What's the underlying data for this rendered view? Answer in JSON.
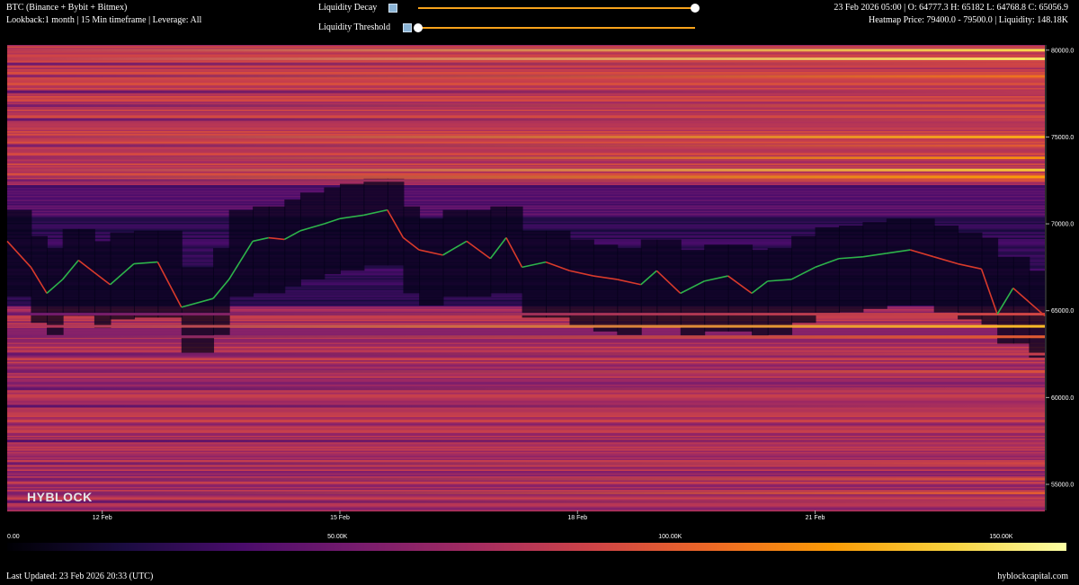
{
  "header": {
    "title": "BTC (Binance + Bybit + Bitmex)",
    "settings": "Lookback:1 month | 15 Min timeframe | Leverage: All",
    "ohlc": "23 Feb 2026 05:00 | O: 64777.3 H: 65182 L: 64768.8 C: 65056.9",
    "range": "Heatmap Price: 79400.0 - 79500.0 | Liquidity: 148.18K"
  },
  "controls": {
    "decay_label": "Liquidity Decay",
    "threshold_label": "Liquidity Threshold",
    "decay_value": 1.0,
    "threshold_value": 0.0
  },
  "brand": "HYBLOCK",
  "footer": {
    "updated": "Last Updated: 23 Feb 2026 20:33 (UTC)",
    "site": "hyblockcapital.com"
  },
  "colorscale": {
    "labels": [
      "0.00",
      "50.00K",
      "100.00K",
      "150.00K"
    ],
    "values": [
      0,
      50000,
      100000,
      150000
    ],
    "max": 160000,
    "stops": [
      "#000004",
      "#1b0c41",
      "#4a0c6b",
      "#781c6d",
      "#a52c60",
      "#cf4446",
      "#ed6925",
      "#fb9b06",
      "#f7d13d",
      "#fcffa4"
    ]
  },
  "chart_data": {
    "type": "heatmap",
    "ylim": [
      53500,
      80300
    ],
    "y_ticks": [
      55000,
      60000,
      65000,
      70000,
      75000,
      80000
    ],
    "y_tick_labels": [
      "55000.0",
      "60000.0",
      "65000.0",
      "70000.0",
      "75000.0",
      "80000.0"
    ],
    "x_ticks": [
      12,
      15,
      18,
      21
    ],
    "x_tick_labels": [
      "12 Feb",
      "15 Feb",
      "18 Feb",
      "21 Feb"
    ],
    "xlim": [
      10.8,
      23.9
    ],
    "price_series": {
      "name": "BTC",
      "x": [
        10.8,
        11.1,
        11.3,
        11.5,
        11.7,
        11.9,
        12.1,
        12.4,
        12.7,
        13.0,
        13.4,
        13.6,
        13.9,
        14.1,
        14.3,
        14.5,
        14.8,
        15.0,
        15.3,
        15.6,
        15.8,
        16.0,
        16.3,
        16.6,
        16.9,
        17.1,
        17.3,
        17.6,
        17.9,
        18.2,
        18.5,
        18.8,
        19.0,
        19.3,
        19.6,
        19.9,
        20.2,
        20.4,
        20.7,
        21.0,
        21.3,
        21.6,
        21.9,
        22.2,
        22.5,
        22.8,
        23.1,
        23.3,
        23.5,
        23.7,
        23.9
      ],
      "y": [
        69000,
        67500,
        66000,
        66800,
        67900,
        67200,
        66500,
        67700,
        67800,
        65200,
        65700,
        66800,
        69000,
        69200,
        69100,
        69600,
        70000,
        70300,
        70500,
        70800,
        69200,
        68500,
        68200,
        69000,
        68000,
        69200,
        67500,
        67800,
        67300,
        67000,
        66800,
        66500,
        67300,
        66000,
        66700,
        67000,
        66000,
        66700,
        66800,
        67500,
        68000,
        68100,
        68300,
        68500,
        68100,
        67700,
        67400,
        64800,
        66300,
        65500,
        64700
      ]
    },
    "liquidity_bands": [
      {
        "price": 80000,
        "value": 145000
      },
      {
        "price": 79500,
        "value": 148180
      },
      {
        "price": 79200,
        "value": 90000
      },
      {
        "price": 78500,
        "value": 110000
      },
      {
        "price": 77600,
        "value": 80000
      },
      {
        "price": 76800,
        "value": 95000
      },
      {
        "price": 76000,
        "value": 85000
      },
      {
        "price": 75000,
        "value": 130000
      },
      {
        "price": 74500,
        "value": 100000
      },
      {
        "price": 73800,
        "value": 120000
      },
      {
        "price": 73100,
        "value": 140000
      },
      {
        "price": 72700,
        "value": 125000
      },
      {
        "price": 72500,
        "value": 95000
      },
      {
        "price": 64800,
        "value": 90000
      },
      {
        "price": 64100,
        "value": 135000
      },
      {
        "price": 63500,
        "value": 100000
      },
      {
        "price": 62500,
        "value": 85000
      },
      {
        "price": 61500,
        "value": 95000
      },
      {
        "price": 60500,
        "value": 80000
      },
      {
        "price": 59500,
        "value": 75000
      },
      {
        "price": 57500,
        "value": 70000
      },
      {
        "price": 56200,
        "value": 90000
      },
      {
        "price": 55300,
        "value": 95000
      },
      {
        "price": 54500,
        "value": 100000
      },
      {
        "price": 54000,
        "value": 80000
      }
    ]
  }
}
